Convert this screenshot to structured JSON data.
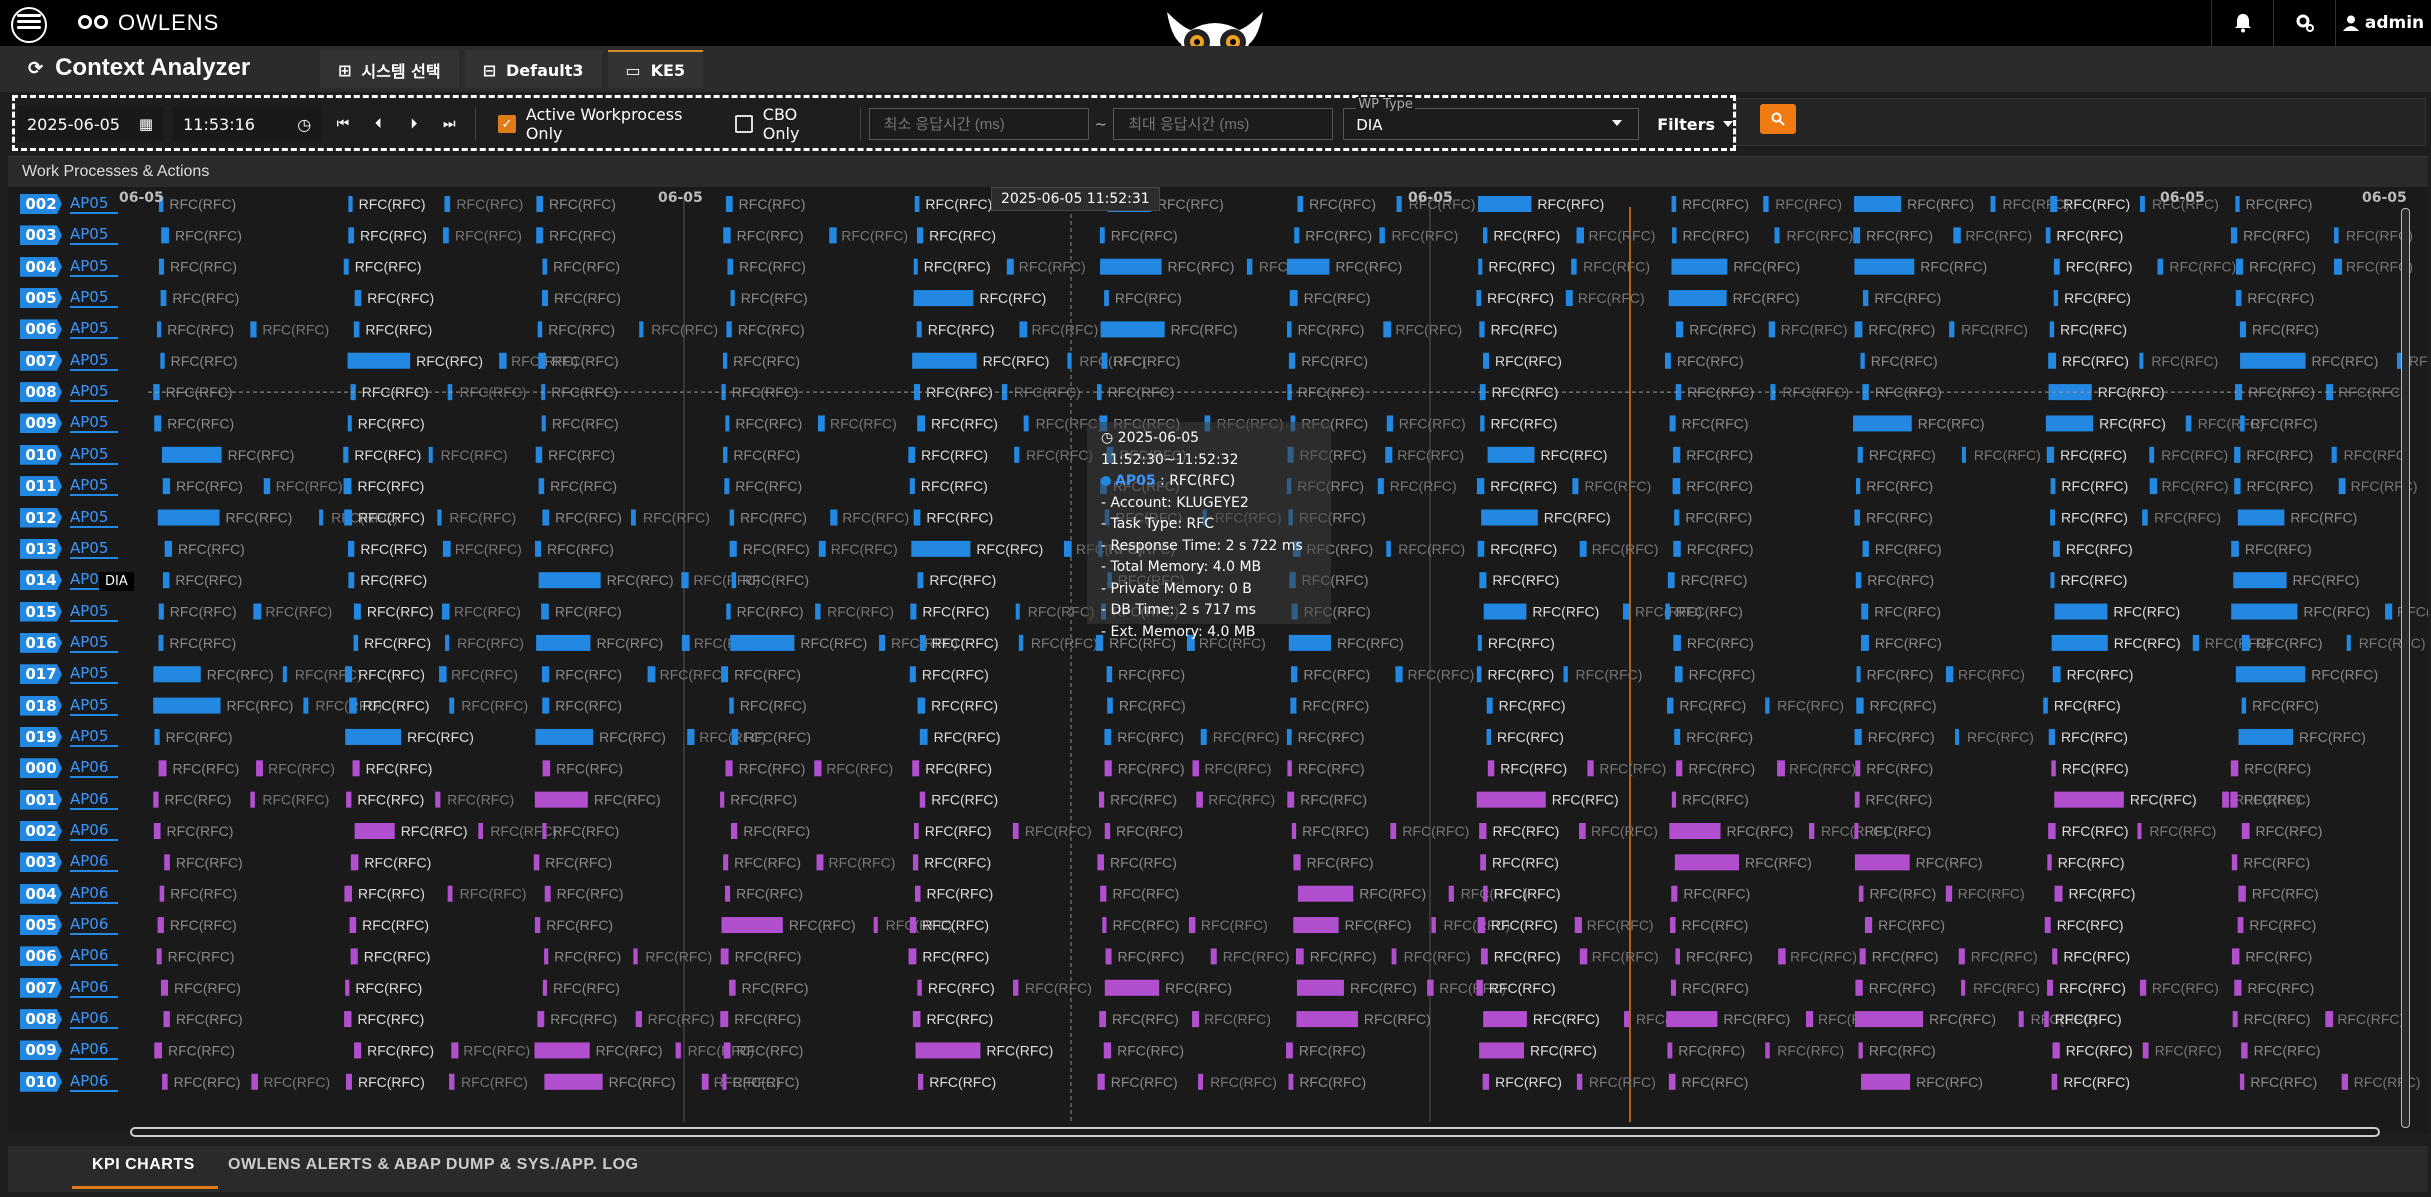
{
  "header": {
    "brand": "OWLENS",
    "user": "admin",
    "icons": [
      "menu-icon",
      "bell-icon",
      "settings-icon",
      "user-icon"
    ]
  },
  "titlebar": {
    "title": "Context Analyzer",
    "tabs": [
      {
        "label": "시스템 선택",
        "icon": "system-icon"
      },
      {
        "label": "Default3",
        "icon": "sitemap-icon"
      },
      {
        "label": "KE5",
        "icon": "monitor-icon"
      }
    ]
  },
  "filters": {
    "date": "2025-06-05",
    "time": "11:53:16",
    "active_wp_label": "Active Workprocess Only",
    "active_wp_checked": true,
    "cbo_label": "CBO Only",
    "cbo_checked": false,
    "min_resp_placeholder": "최소 응답시간 (ms)",
    "tilde": "~",
    "max_resp_placeholder": "최대 응답시간 (ms)",
    "wp_type_label": "WP Type",
    "wp_type_value": "DIA",
    "filters_label": "Filters"
  },
  "panel": {
    "title": "Work Processes & Actions",
    "date_labels": [
      "06-05",
      "06-05",
      "06-05",
      "06-05",
      "06-05"
    ],
    "cursor_time": "2025-06-05 11:52:31",
    "dia_tag": "DIA",
    "rows": [
      {
        "num": "002",
        "ap": "AP05"
      },
      {
        "num": "003",
        "ap": "AP05"
      },
      {
        "num": "004",
        "ap": "AP05"
      },
      {
        "num": "005",
        "ap": "AP05"
      },
      {
        "num": "006",
        "ap": "AP05"
      },
      {
        "num": "007",
        "ap": "AP05"
      },
      {
        "num": "008",
        "ap": "AP05"
      },
      {
        "num": "009",
        "ap": "AP05"
      },
      {
        "num": "010",
        "ap": "AP05"
      },
      {
        "num": "011",
        "ap": "AP05"
      },
      {
        "num": "012",
        "ap": "AP05"
      },
      {
        "num": "013",
        "ap": "AP05"
      },
      {
        "num": "014",
        "ap": "AP05"
      },
      {
        "num": "015",
        "ap": "AP05"
      },
      {
        "num": "016",
        "ap": "AP05"
      },
      {
        "num": "017",
        "ap": "AP05"
      },
      {
        "num": "018",
        "ap": "AP05"
      },
      {
        "num": "019",
        "ap": "AP05"
      },
      {
        "num": "000",
        "ap": "AP06"
      },
      {
        "num": "001",
        "ap": "AP06"
      },
      {
        "num": "002",
        "ap": "AP06"
      },
      {
        "num": "003",
        "ap": "AP06"
      },
      {
        "num": "004",
        "ap": "AP06"
      },
      {
        "num": "005",
        "ap": "AP06"
      },
      {
        "num": "006",
        "ap": "AP06"
      },
      {
        "num": "007",
        "ap": "AP06"
      },
      {
        "num": "008",
        "ap": "AP06"
      },
      {
        "num": "009",
        "ap": "AP06"
      },
      {
        "num": "010",
        "ap": "AP06"
      }
    ],
    "action_label": "RFC(RFC)",
    "colors": {
      "ap05": "#2288e2",
      "ap06": "#b24fcf",
      "marker": "#e07b1a"
    }
  },
  "tooltip": {
    "time_range": "2025-06-05 11:52:30~11:52:32",
    "ap": "AP05",
    "action": ": RFC(RFC)",
    "account": "- Account: KLUGEYE2",
    "task_type": "- Task Type: RFC",
    "response_time": "- Response Time: 2 s 722 ms",
    "total_memory": "- Total Memory: 4.0 MB",
    "private_memory": "- Private Memory: 0 B",
    "db_time": "- DB Time: 2 s 717 ms",
    "ext_memory": "- Ext. Memory: 4.0 MB"
  },
  "bottom_tabs": {
    "kpi": "KPI CHARTS",
    "alerts": "OWLENS ALERTS & ABAP DUMP & SYS./APP. LOG"
  }
}
